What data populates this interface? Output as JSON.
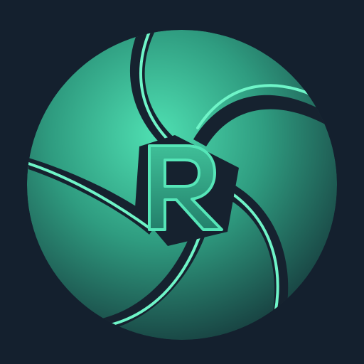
{
  "app_icon": {
    "monogram": "R",
    "icon_name": "camera-aperture-icon",
    "colors": {
      "background": "#14202e",
      "gap": "#16222f",
      "blade_light": "#4fe0b2",
      "blade_mid": "#2f9c80",
      "blade_dark": "#163a3c",
      "edge_highlight": "#6ff5c8",
      "monogram_fill": "#2f9e82",
      "monogram_stroke": "#56e6b8"
    }
  }
}
